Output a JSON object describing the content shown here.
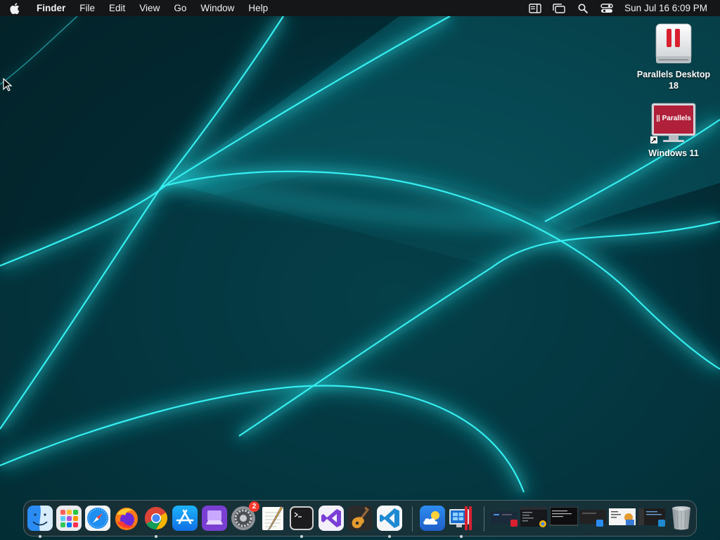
{
  "menubar": {
    "app_name": "Finder",
    "menus": [
      "File",
      "Edit",
      "View",
      "Go",
      "Window",
      "Help"
    ],
    "clock": "Sun Jul 16  6:09 PM",
    "status_icons": [
      "sidebar-toggle-icon",
      "stage-manager-icon",
      "spotlight-search-icon",
      "control-center-icon"
    ]
  },
  "desktop": {
    "icons": [
      {
        "label": "Parallels Desktop 18",
        "icon": "parallels-desktop-icon"
      },
      {
        "label": "Windows 11",
        "icon": "windows-vm-icon",
        "badge_text": "|| Parallels"
      }
    ]
  },
  "dock": {
    "apps": [
      {
        "name": "Finder",
        "icon": "finder-icon",
        "running": true
      },
      {
        "name": "Launchpad",
        "icon": "launchpad-icon",
        "running": false
      },
      {
        "name": "Safari",
        "icon": "safari-icon",
        "running": false
      },
      {
        "name": "Firefox",
        "icon": "firefox-icon",
        "running": false
      },
      {
        "name": "Google Chrome",
        "icon": "chrome-icon",
        "running": true
      },
      {
        "name": "App Store",
        "icon": "app-store-icon",
        "running": false
      },
      {
        "name": "Simulator",
        "icon": "simulator-icon",
        "running": false
      },
      {
        "name": "System Settings",
        "icon": "system-settings-icon",
        "running": false,
        "badge": "2"
      },
      {
        "name": "TextEdit",
        "icon": "textedit-icon",
        "running": false
      },
      {
        "name": "Terminal",
        "icon": "terminal-icon",
        "running": true
      },
      {
        "name": "Visual Studio",
        "icon": "visual-studio-icon",
        "running": false
      },
      {
        "name": "GarageBand",
        "icon": "garageband-icon",
        "running": false
      },
      {
        "name": "Visual Studio Code",
        "icon": "vscode-icon",
        "running": true
      },
      {
        "name": "Weather",
        "icon": "weather-icon",
        "running": false
      },
      {
        "name": "Parallels Desktop",
        "icon": "parallels-dock-icon",
        "running": true
      }
    ],
    "minimized": [
      "minimized-window-1",
      "minimized-chrome-window",
      "minimized-terminal-window",
      "minimized-window-4",
      "minimized-window-5",
      "minimized-window-6",
      "minimized-vscode-window"
    ],
    "trash": "trash-icon"
  },
  "colors": {
    "menubar_bg": "#141618",
    "wallpaper_base": "#021a1f",
    "wallpaper_glow": "#27e3e3"
  }
}
